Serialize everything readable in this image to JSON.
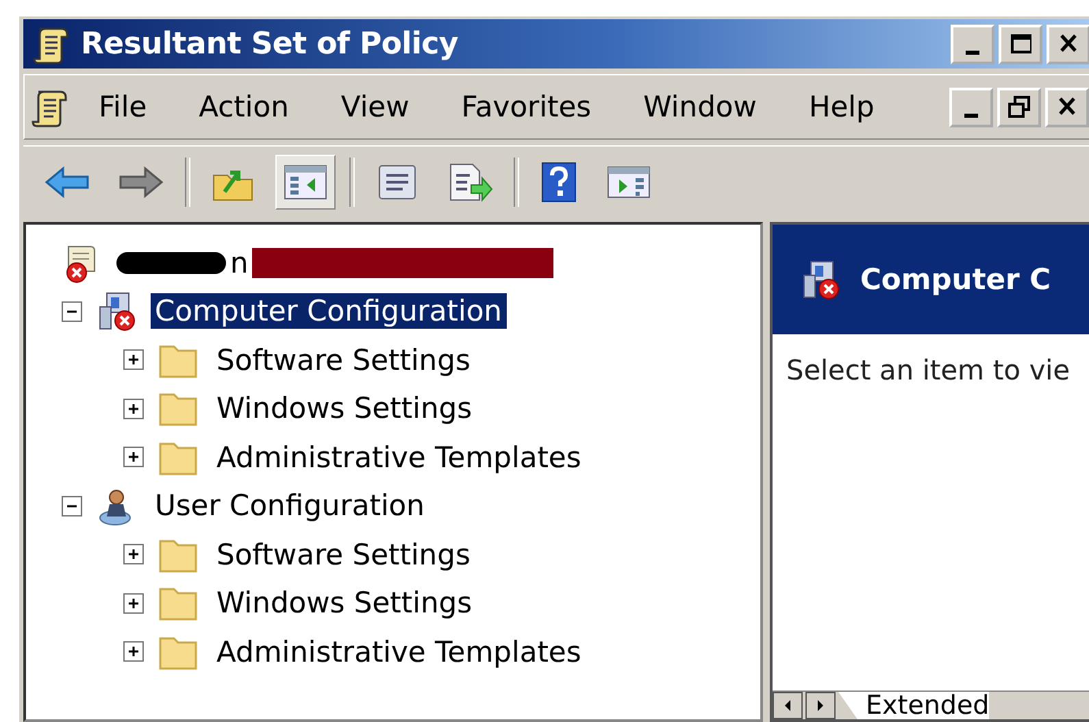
{
  "window": {
    "title": "Resultant Set of Policy"
  },
  "menu": [
    "File",
    "Action",
    "View",
    "Favorites",
    "Window",
    "Help"
  ],
  "toolbar": [
    {
      "kind": "back",
      "pressed": false
    },
    {
      "kind": "forward",
      "pressed": false
    },
    {
      "kind": "separator"
    },
    {
      "kind": "up",
      "pressed": false
    },
    {
      "kind": "console-tree",
      "pressed": true
    },
    {
      "kind": "separator"
    },
    {
      "kind": "properties",
      "pressed": false
    },
    {
      "kind": "export",
      "pressed": false
    },
    {
      "kind": "separator"
    },
    {
      "kind": "help",
      "pressed": false
    },
    {
      "kind": "action-pane",
      "pressed": false
    }
  ],
  "tree": {
    "label": "n",
    "kind": "root",
    "redacted": true,
    "selected": false,
    "children": [
      {
        "label": "Computer Configuration",
        "kind": "computer",
        "expanded": true,
        "selected": true,
        "children": [
          {
            "label": "Software Settings",
            "kind": "folder",
            "expanded": false,
            "selected": false
          },
          {
            "label": "Windows Settings",
            "kind": "folder",
            "expanded": false,
            "selected": false
          },
          {
            "label": "Administrative Templates",
            "kind": "folder",
            "expanded": false,
            "selected": false
          }
        ]
      },
      {
        "label": "User Configuration",
        "kind": "user",
        "expanded": true,
        "selected": false,
        "children": [
          {
            "label": "Software Settings",
            "kind": "folder",
            "expanded": false,
            "selected": false
          },
          {
            "label": "Windows Settings",
            "kind": "folder",
            "expanded": false,
            "selected": false
          },
          {
            "label": "Administrative Templates",
            "kind": "folder",
            "expanded": false,
            "selected": false
          }
        ]
      }
    ]
  },
  "detail": {
    "header": "Computer C",
    "message": "Select an item to vie"
  },
  "bottom_tabs": [
    {
      "label": "Extended",
      "selected": true
    }
  ]
}
